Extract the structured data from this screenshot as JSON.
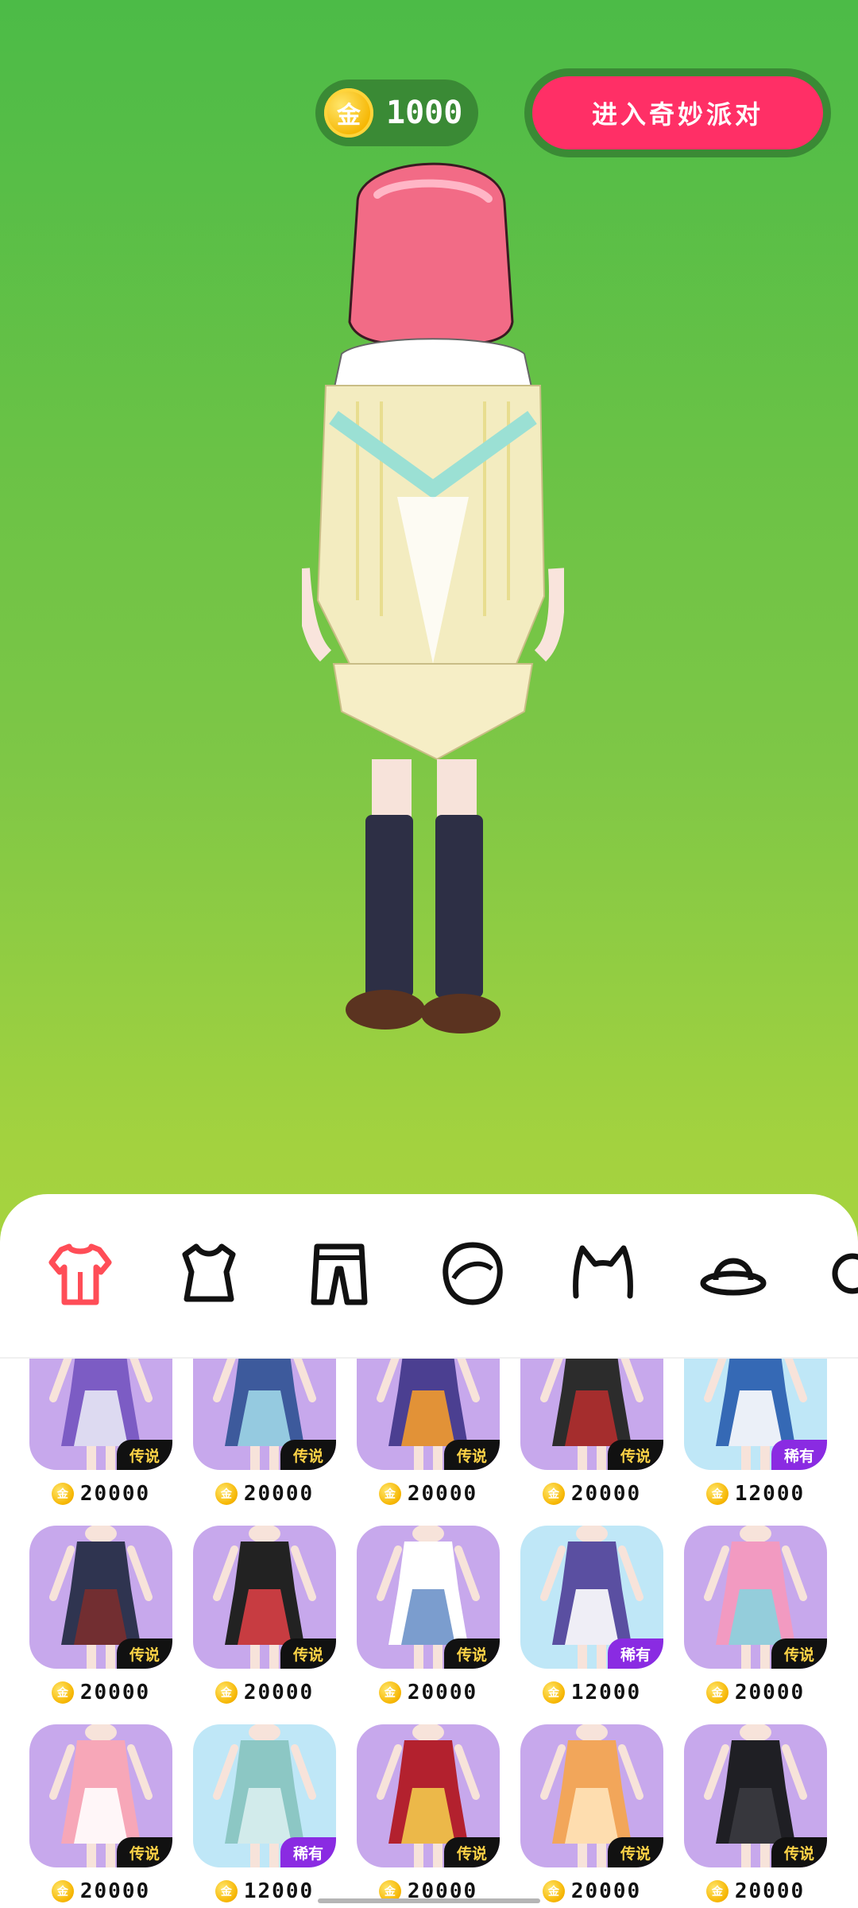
{
  "hud": {
    "coin_icon_text": "金",
    "coin_balance": "1000",
    "enter_button_label": "进入奇妙派对"
  },
  "colors": {
    "bg_top": "#4cbb47",
    "bg_bottom": "#b9de3d",
    "accent": "#ff2f66",
    "tab_active": "#ff4d57",
    "card_purple": "#c7a8ec",
    "card_blue": "#bfe7f7"
  },
  "tabs": [
    {
      "icon": "dress-icon",
      "active": true
    },
    {
      "icon": "top-icon",
      "active": false
    },
    {
      "icon": "pants-icon",
      "active": false
    },
    {
      "icon": "hair-icon",
      "active": false
    },
    {
      "icon": "cat-ears-icon",
      "active": false
    },
    {
      "icon": "hat-icon",
      "active": false
    },
    {
      "icon": "accessory-icon",
      "active": false
    }
  ],
  "items": [
    {
      "bg": "purple",
      "badge": "传说",
      "rarity": "legend",
      "coin": "金",
      "price": "20000"
    },
    {
      "bg": "purple",
      "badge": "传说",
      "rarity": "legend",
      "coin": "金",
      "price": "20000"
    },
    {
      "bg": "purple",
      "badge": "传说",
      "rarity": "legend",
      "coin": "金",
      "price": "20000"
    },
    {
      "bg": "purple",
      "badge": "传说",
      "rarity": "legend",
      "coin": "金",
      "price": "20000"
    },
    {
      "bg": "blue",
      "badge": "稀有",
      "rarity": "rare",
      "coin": "金",
      "price": "12000"
    },
    {
      "bg": "purple",
      "badge": "传说",
      "rarity": "legend",
      "coin": "金",
      "price": "20000"
    },
    {
      "bg": "purple",
      "badge": "传说",
      "rarity": "legend",
      "coin": "金",
      "price": "20000"
    },
    {
      "bg": "purple",
      "badge": "传说",
      "rarity": "legend",
      "coin": "金",
      "price": "20000"
    },
    {
      "bg": "blue",
      "badge": "稀有",
      "rarity": "rare",
      "coin": "金",
      "price": "12000"
    },
    {
      "bg": "purple",
      "badge": "传说",
      "rarity": "legend",
      "coin": "金",
      "price": "20000"
    },
    {
      "bg": "purple",
      "badge": "传说",
      "rarity": "legend",
      "coin": "金",
      "price": "20000"
    },
    {
      "bg": "blue",
      "badge": "稀有",
      "rarity": "rare",
      "coin": "金",
      "price": "12000"
    },
    {
      "bg": "purple",
      "badge": "传说",
      "rarity": "legend",
      "coin": "金",
      "price": "20000"
    },
    {
      "bg": "purple",
      "badge": "传说",
      "rarity": "legend",
      "coin": "金",
      "price": "20000"
    },
    {
      "bg": "purple",
      "badge": "传说",
      "rarity": "legend",
      "coin": "金",
      "price": "20000"
    }
  ]
}
